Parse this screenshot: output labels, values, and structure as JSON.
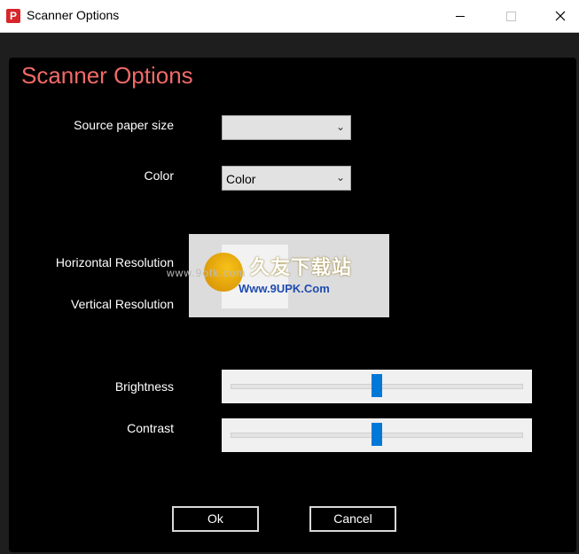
{
  "window": {
    "title": "Scanner Options",
    "app_icon_letter": "P"
  },
  "dialog": {
    "heading": "Scanner Options",
    "fields": {
      "source_paper_size": {
        "label": "Source paper size",
        "value": ""
      },
      "color": {
        "label": "Color",
        "value": "Color"
      },
      "horizontal_resolution": {
        "label": "Horizontal Resolution"
      },
      "vertical_resolution": {
        "label": "Vertical Resolution"
      },
      "brightness": {
        "label": "Brightness",
        "level": 0.5
      },
      "contrast": {
        "label": "Contrast",
        "level": 0.5
      }
    },
    "buttons": {
      "ok": "Ok",
      "cancel": "Cancel"
    }
  },
  "watermark": {
    "brand": "久友下载站",
    "url": "Www.9UPK.Com",
    "left_text": "www.9ofk.com"
  },
  "colors": {
    "heading": "#f06a68",
    "panel_bg": "#000000",
    "slider_thumb": "#0078d7"
  }
}
